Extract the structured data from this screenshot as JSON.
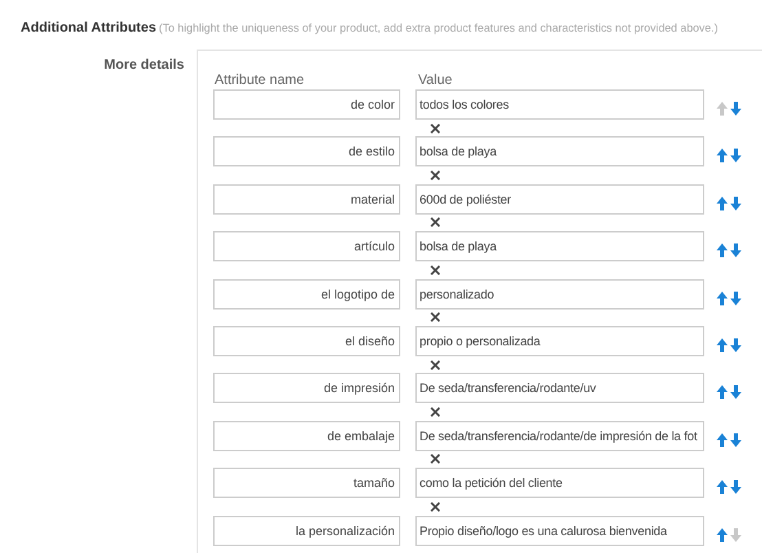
{
  "section": {
    "title": "Additional Attributes",
    "hint": "(To highlight the uniqueness of your product, add extra product features and characteristics not provided above.)"
  },
  "label": "More details",
  "columns": [
    "Attribute name",
    "Value"
  ],
  "rows": [
    {
      "name": "de color",
      "value": "todos los colores",
      "up_enabled": false,
      "down_enabled": true,
      "remove": true
    },
    {
      "name": "de estilo",
      "value": "bolsa de playa",
      "up_enabled": true,
      "down_enabled": true,
      "remove": true
    },
    {
      "name": "material",
      "value": "600d de poliéster",
      "up_enabled": true,
      "down_enabled": true,
      "remove": true
    },
    {
      "name": "artículo",
      "value": "bolsa de playa",
      "up_enabled": true,
      "down_enabled": true,
      "remove": true
    },
    {
      "name": "el logotipo de",
      "value": "personalizado",
      "up_enabled": true,
      "down_enabled": true,
      "remove": true
    },
    {
      "name": "el diseño",
      "value": "propio o personalizada",
      "up_enabled": true,
      "down_enabled": true,
      "remove": true
    },
    {
      "name": "de impresión",
      "value": "De seda/transferencia/rodante/uv",
      "up_enabled": true,
      "down_enabled": true,
      "remove": true
    },
    {
      "name": "de embalaje",
      "value": "De seda/transferencia/rodante/de impresión de la fot",
      "up_enabled": true,
      "down_enabled": true,
      "remove": true
    },
    {
      "name": "tamaño",
      "value": "como la petición del cliente",
      "up_enabled": true,
      "down_enabled": true,
      "remove": true
    },
    {
      "name": "la personalización",
      "value": "Propio diseño/logo es una calurosa bienvenida",
      "up_enabled": true,
      "down_enabled": false,
      "remove": false
    }
  ]
}
